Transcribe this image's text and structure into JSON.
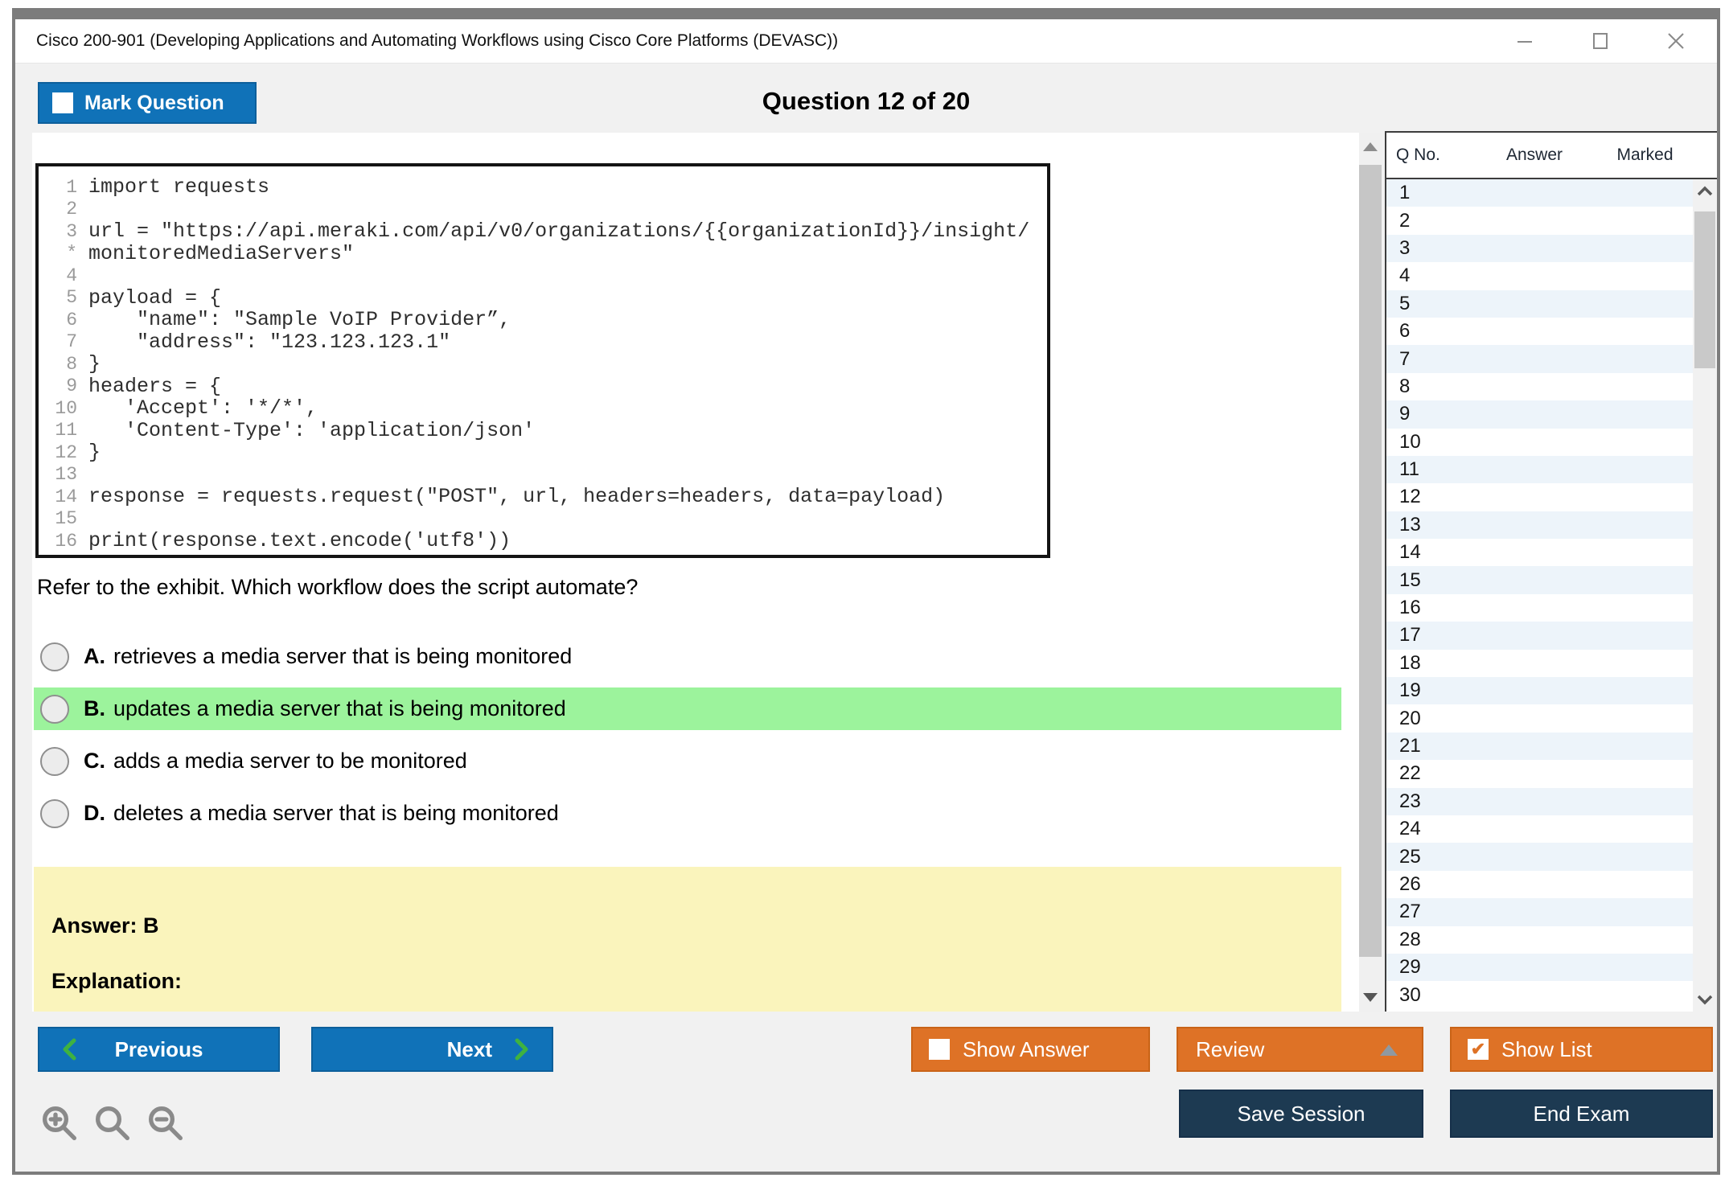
{
  "window": {
    "title": "Cisco 200-901 (Developing Applications and Automating Workflows using Cisco Core Platforms (DEVASC))"
  },
  "header": {
    "mark_question": "Mark Question",
    "counter": "Question 12 of 20"
  },
  "exhibit": {
    "lines": [
      {
        "n": "1",
        "c": "import requests"
      },
      {
        "n": "2",
        "c": ""
      },
      {
        "n": "3",
        "c": "url = \"https://api.meraki.com/api/v0/organizations/{{organizationId}}/insight/"
      },
      {
        "n": "*",
        "c": "monitoredMediaServers\""
      },
      {
        "n": "4",
        "c": ""
      },
      {
        "n": "5",
        "c": "payload = {"
      },
      {
        "n": "6",
        "c": "    \"name\": \"Sample VoIP Provider”,"
      },
      {
        "n": "7",
        "c": "    \"address\": \"123.123.123.1\""
      },
      {
        "n": "8",
        "c": "}"
      },
      {
        "n": "9",
        "c": "headers = {"
      },
      {
        "n": "10",
        "c": "   'Accept': '*/*',"
      },
      {
        "n": "11",
        "c": "   'Content-Type': 'application/json'"
      },
      {
        "n": "12",
        "c": "}"
      },
      {
        "n": "13",
        "c": ""
      },
      {
        "n": "14",
        "c": "response = requests.request(\"POST\", url, headers=headers, data=payload)"
      },
      {
        "n": "15",
        "c": ""
      },
      {
        "n": "16",
        "c": "print(response.text.encode('utf8'))"
      }
    ]
  },
  "question": {
    "text": "Refer to the exhibit. Which workflow does the script automate?",
    "options": [
      {
        "letter": "A.",
        "text": "retrieves a media server that is being monitored",
        "highlighted": false
      },
      {
        "letter": "B.",
        "text": "updates a media server that is being monitored",
        "highlighted": true
      },
      {
        "letter": "C.",
        "text": "adds a media server to be monitored",
        "highlighted": false
      },
      {
        "letter": "D.",
        "text": "deletes a media server that is being monitored",
        "highlighted": false
      }
    ]
  },
  "answer_panel": {
    "answer": "Answer: B",
    "explanation": "Explanation:"
  },
  "sidebar": {
    "columns": {
      "q_no": "Q No.",
      "answer": "Answer",
      "marked": "Marked"
    },
    "rows": [
      {
        "q": "1"
      },
      {
        "q": "2"
      },
      {
        "q": "3"
      },
      {
        "q": "4"
      },
      {
        "q": "5"
      },
      {
        "q": "6"
      },
      {
        "q": "7"
      },
      {
        "q": "8"
      },
      {
        "q": "9"
      },
      {
        "q": "10"
      },
      {
        "q": "11"
      },
      {
        "q": "12"
      },
      {
        "q": "13"
      },
      {
        "q": "14"
      },
      {
        "q": "15"
      },
      {
        "q": "16"
      },
      {
        "q": "17"
      },
      {
        "q": "18"
      },
      {
        "q": "19"
      },
      {
        "q": "20"
      },
      {
        "q": "21"
      },
      {
        "q": "22"
      },
      {
        "q": "23"
      },
      {
        "q": "24"
      },
      {
        "q": "25"
      },
      {
        "q": "26"
      },
      {
        "q": "27"
      },
      {
        "q": "28"
      },
      {
        "q": "29"
      },
      {
        "q": "30"
      }
    ]
  },
  "footer": {
    "previous": "Previous",
    "next": "Next",
    "show_answer": "Show Answer",
    "review": "Review",
    "show_list": "Show List",
    "save_session": "Save Session",
    "end_exam": "End Exam"
  },
  "colors": {
    "blue": "#1072b8",
    "orange": "#de7226",
    "navy": "#1d3a52",
    "green-hl": "#9cf39c",
    "yellow": "#faf4bc",
    "green-chev": "#3fb240",
    "alt-row": "#edf4fa"
  }
}
